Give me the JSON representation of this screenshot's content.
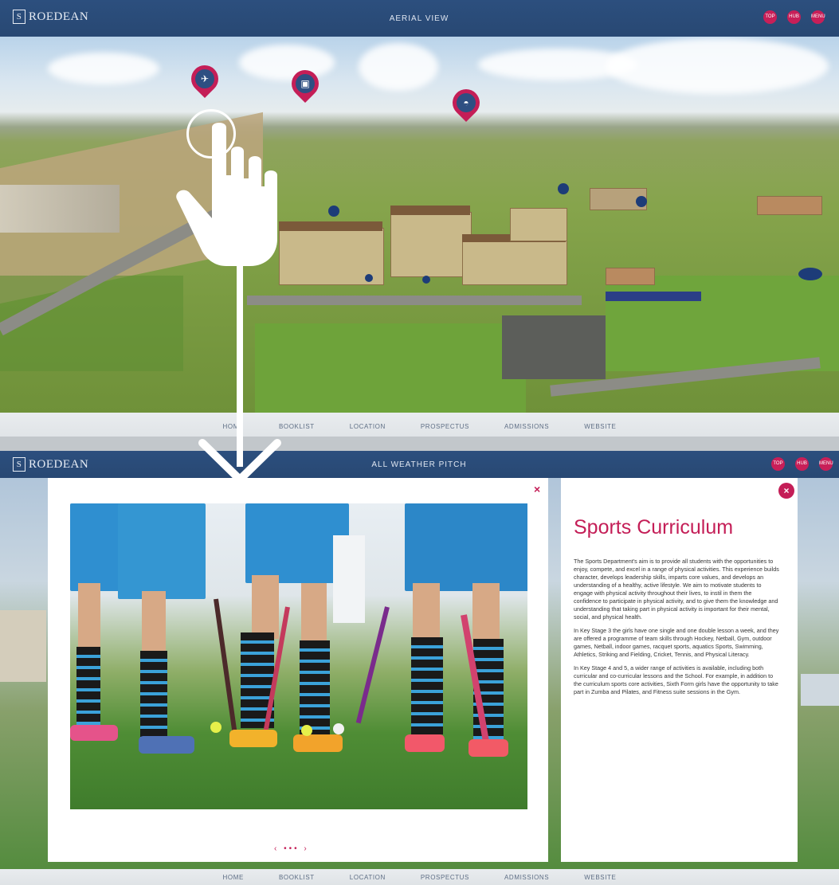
{
  "top": {
    "logo": "ROEDEAN",
    "title": "AERIAL VIEW",
    "buttons": [
      "TOP",
      "HUB",
      "MENU"
    ],
    "nav": [
      "HOME",
      "BOOKLIST",
      "LOCATION",
      "PROSPECTUS",
      "ADMISSIONS",
      "WEBSITE"
    ]
  },
  "bottom": {
    "logo": "ROEDEAN",
    "title": "ALL WEATHER PITCH",
    "buttons": [
      "TOP",
      "HUB",
      "MENU"
    ],
    "nav": [
      "HOME",
      "BOOKLIST",
      "LOCATION",
      "PROSPECTUS",
      "ADMISSIONS",
      "WEBSITE"
    ],
    "modal": {
      "close_symbol": "×",
      "pager_prev": "‹",
      "pager_dots": "•••",
      "pager_next": "›",
      "heading": "Sports Curriculum",
      "close_circle": "×",
      "paragraphs": [
        "The Sports Department's aim is to provide all students with the opportunities to enjoy, compete, and excel in a range of physical activities. This experience builds character, develops leadership skills, imparts core values, and develops an understanding of a healthy, active lifestyle. We aim to motivate students to engage with physical activity throughout their lives, to instil in them the confidence to participate in physical activity, and to give them the knowledge and understanding that taking part in physical activity is important for their mental, social, and physical health.",
        "In Key Stage 3 the girls have one single and one double lesson a week, and they are offered a programme of team skills through Hockey, Netball, Gym, outdoor games, Netball, indoor games, racquet sports, aquatics Sports, Swimming, Athletics, Striking and Fielding, Cricket, Tennis, and Physical Literacy.",
        "In Key Stage 4 and 5, a wider range of activities is available, including both curricular and co-curricular lessons and the School. For example, in addition to the curriculum sports core activities, Sixth Form girls have the opportunity to take part in Zumba and Pilates, and Fitness suite sessions in the Gym."
      ]
    }
  },
  "colors": {
    "navy": "#2c4f7e",
    "accent": "#c41e57",
    "pin_inner": "#2e4f82"
  },
  "icons": [
    "helicopter-icon",
    "bus-icon",
    "car-icon",
    "tap-hand-icon",
    "down-arrow-icon"
  ]
}
